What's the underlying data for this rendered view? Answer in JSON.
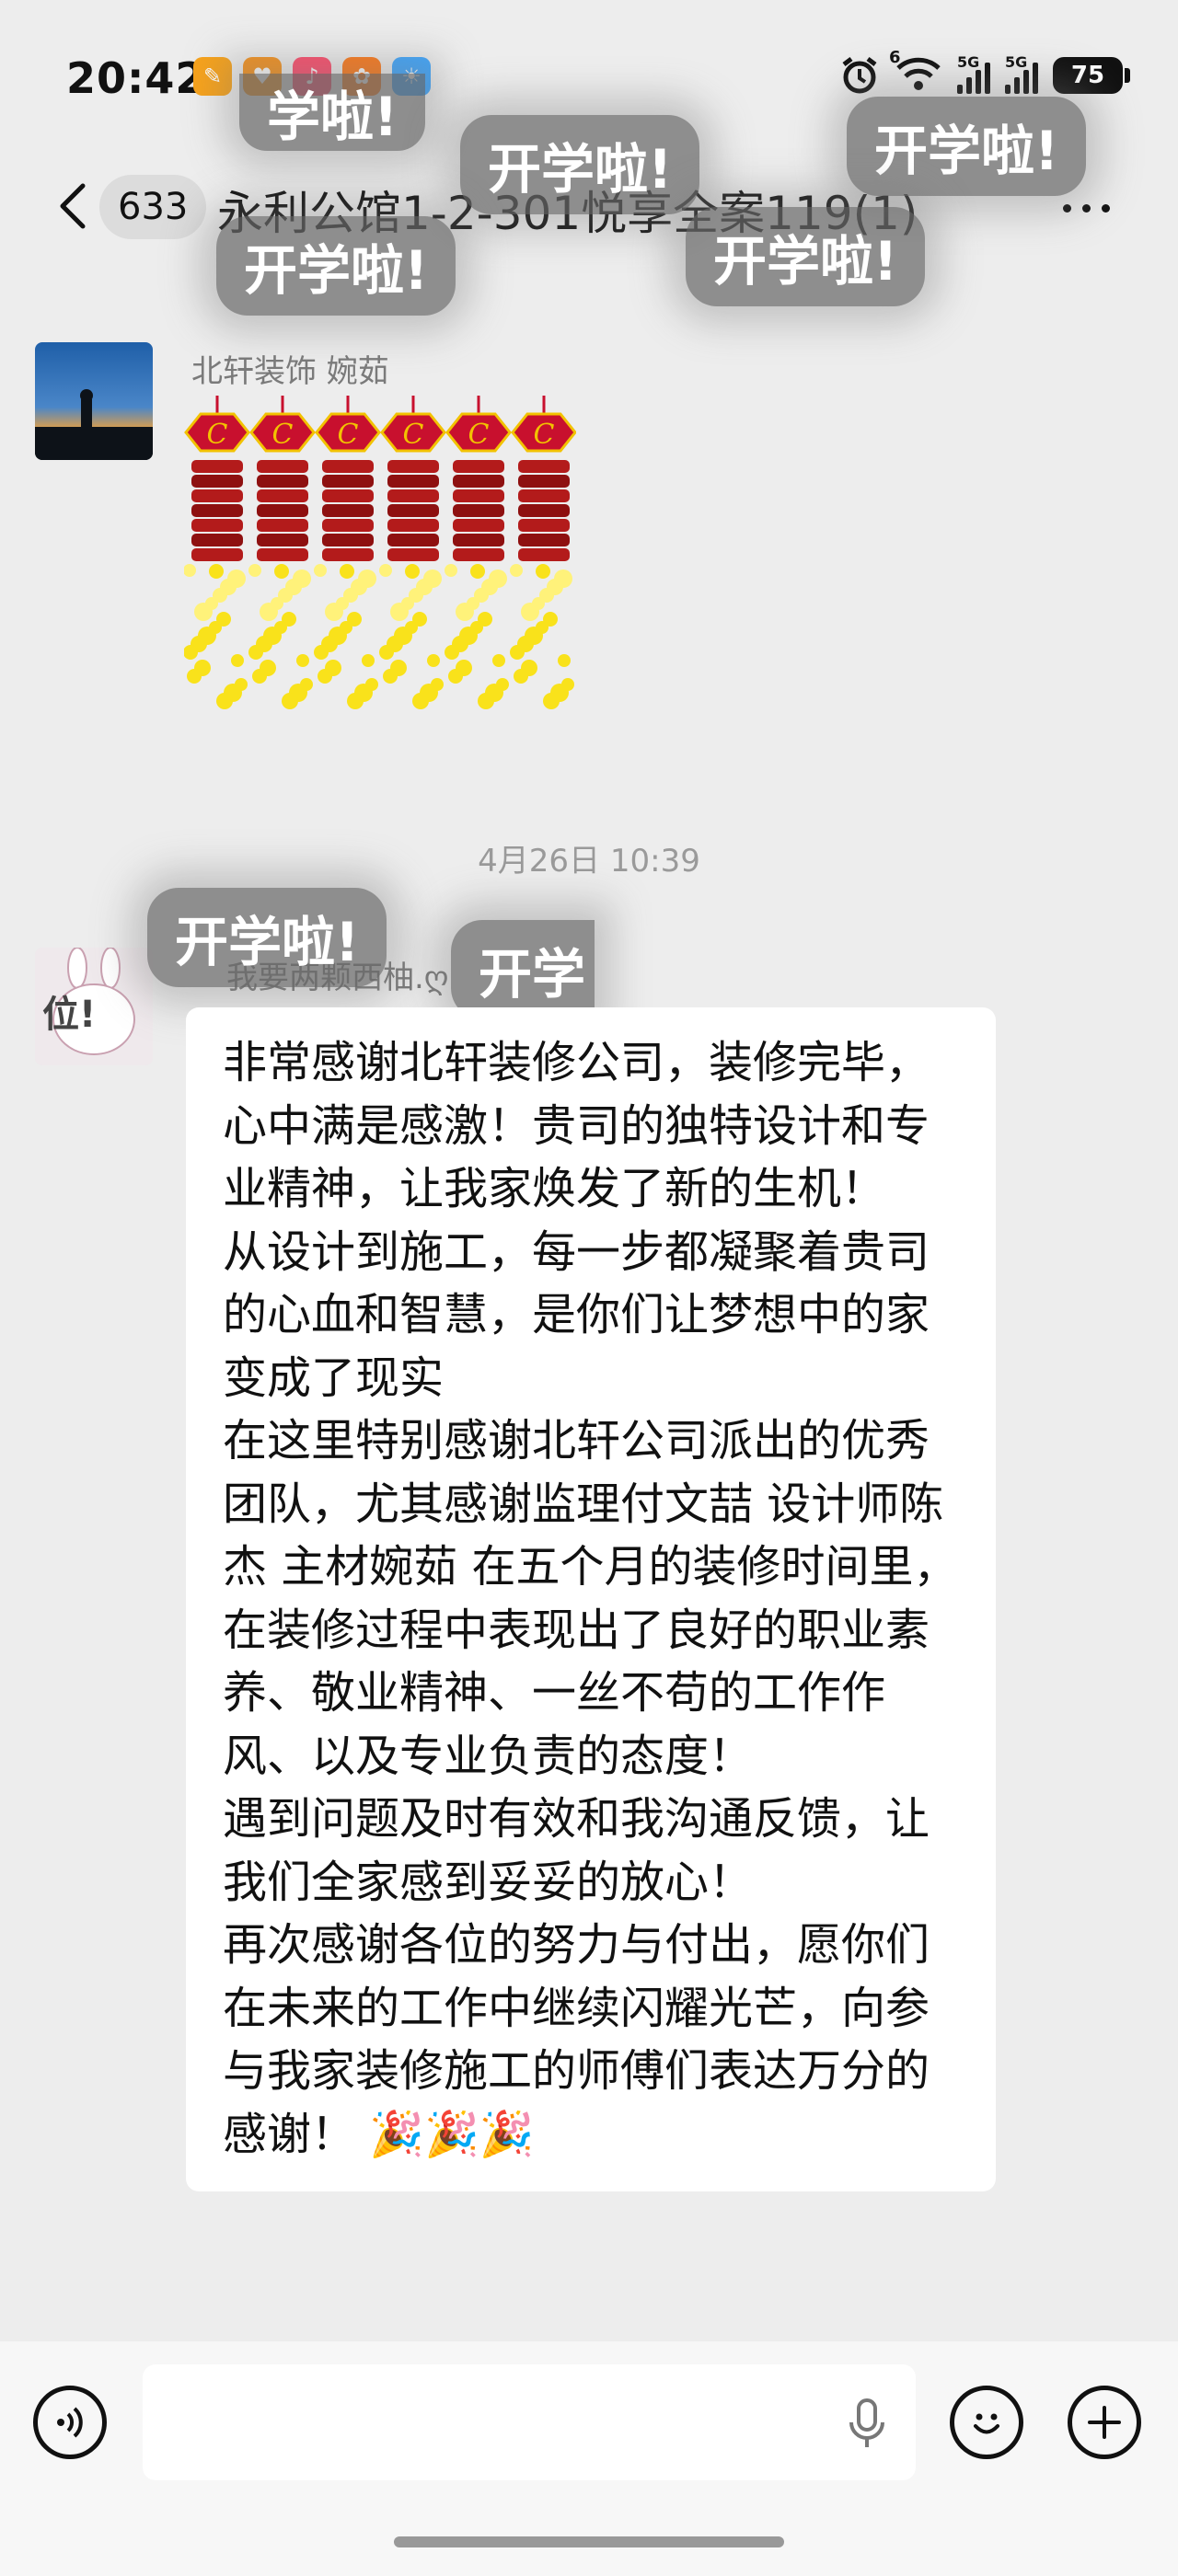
{
  "status_bar": {
    "time": "20:42",
    "app_icons": [
      {
        "name": "app-icon-1",
        "color": "#f7a21b",
        "glyph": "✎"
      },
      {
        "name": "app-icon-2",
        "color": "#f7931e",
        "glyph": "♥"
      },
      {
        "name": "music-app-icon",
        "color": "#ff4d6d",
        "glyph": "♪"
      },
      {
        "name": "app-icon-4",
        "color": "#ff7a1a",
        "glyph": "✿"
      },
      {
        "name": "weather-app-icon",
        "color": "#3fa7ff",
        "glyph": "☀"
      }
    ],
    "wifi_label": "6",
    "signal1_label": "5G",
    "signal2_label": "5G",
    "battery": "75"
  },
  "header": {
    "unread_count": "633",
    "title": "永利公馆1-2-301悦享全案119(1)"
  },
  "effects": {
    "sticker_text": "开学啦!",
    "sticker_text_partial_top": "学啦!",
    "sticker_text_partial_mid": "开学"
  },
  "messages": [
    {
      "sender": "北轩装饰  婉茹",
      "type": "sticker",
      "sticker_name": "firecracker-sticker"
    },
    {
      "timestamp": "4月26日 10:39"
    },
    {
      "sender": "我要两颗西柚.ღ",
      "avatar_text": "位!",
      "type": "text",
      "paragraphs": [
        "非常感谢北轩装修公司，装修完毕，心中满是感激！贵司的独特设计和专业精神，让我家焕发了新的生机！",
        "从设计到施工，每一步都凝聚着贵司的心血和智慧，是你们让梦想中的家变成了现实",
        "在这里特别感谢北轩公司派出的优秀团队，尤其感谢监理付文喆 设计师陈杰 主材婉茹 在五个月的装修时间里，在装修过程中表现出了良好的职业素养、敬业精神、一丝不苟的工作作风、以及专业负责的态度！",
        "遇到问题及时有效和我沟通反馈，让我们全家感到妥妥的放心！",
        "再次感谢各位的努力与付出，愿你们在未来的工作中继续闪耀光芒，向参与我家装修施工的师傅们表达万分的感谢！ 🎉🎉🎉"
      ]
    }
  ],
  "input_bar": {
    "placeholder": ""
  }
}
